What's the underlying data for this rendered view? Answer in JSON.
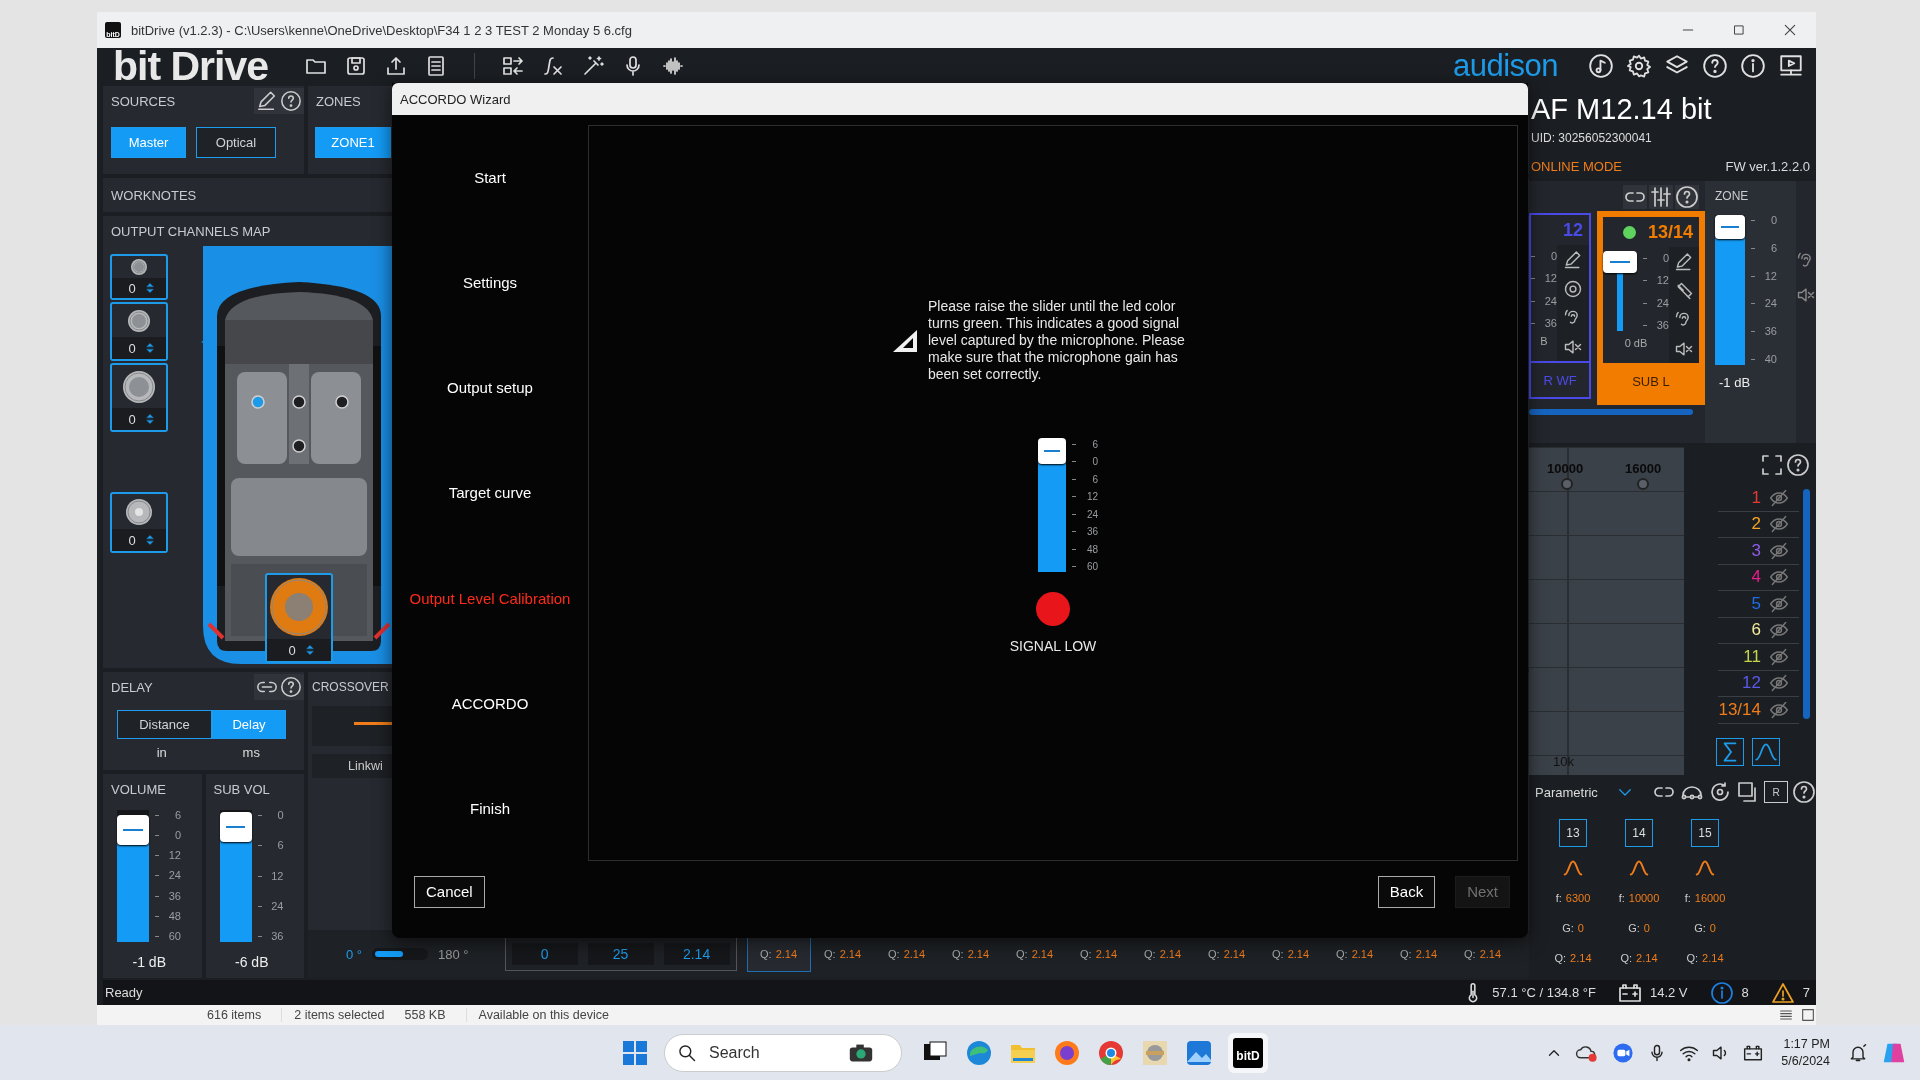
{
  "window": {
    "icon_label": "bitD",
    "title": "bitDrive (v1.2.3) - C:\\Users\\kenne\\OneDrive\\Desktop\\F34 1 2 3 TEST 2 Monday 5 6.cfg"
  },
  "header": {
    "logo": "bit Drive",
    "brand": "audison"
  },
  "sources": {
    "title": "SOURCES",
    "items": [
      {
        "label": "Master",
        "selected": true
      },
      {
        "label": "Optical",
        "selected": false
      }
    ]
  },
  "zones": {
    "title": "ZONES",
    "items": [
      {
        "label": "ZONE1",
        "selected": true
      }
    ]
  },
  "worknotes": {
    "title": "WORKNOTES"
  },
  "output_map": {
    "title": "OUTPUT CHANNELS MAP",
    "speakers": [
      {
        "kind": "tweeter",
        "value": "0",
        "selected": false
      },
      {
        "kind": "midrange",
        "value": "0",
        "selected": false
      },
      {
        "kind": "woofer",
        "value": "0",
        "selected": false
      },
      {
        "kind": "fullrange",
        "value": "0",
        "selected": false
      },
      {
        "kind": "subwoofer",
        "value": "0",
        "selected": true
      }
    ],
    "listening_positions": [
      {
        "selected": true
      },
      {
        "selected": false
      },
      {
        "selected": false
      },
      {
        "selected": false
      }
    ]
  },
  "delay": {
    "title": "DELAY",
    "modes": [
      {
        "label": "Distance",
        "selected": false
      },
      {
        "label": "Delay",
        "selected": true
      }
    ],
    "units": [
      "in",
      "ms"
    ]
  },
  "volume": {
    "title": "VOLUME",
    "level": 0.85,
    "ticks": [
      "6",
      "0",
      "12",
      "24",
      "36",
      "48",
      "60"
    ],
    "reading": "-1 dB"
  },
  "sub_volume": {
    "title": "SUB VOL",
    "level": 0.87,
    "ticks": [
      "0",
      "6",
      "12",
      "24",
      "36"
    ],
    "reading": "-6 dB"
  },
  "crossover": {
    "title": "CROSSOVER",
    "filter_button": "Linkwi",
    "phase": {
      "min": "0 °",
      "max": "180 °",
      "level": 0.55
    }
  },
  "eq_strip": {
    "fields": [
      "0",
      "25",
      "2.14"
    ],
    "q_cells": [
      {
        "label": "Q:",
        "value": "2.14",
        "selected": true
      },
      {
        "label": "Q:",
        "value": "2.14",
        "selected": false
      },
      {
        "label": "Q:",
        "value": "2.14",
        "selected": false
      },
      {
        "label": "Q:",
        "value": "2.14",
        "selected": false
      },
      {
        "label": "Q:",
        "value": "2.14",
        "selected": false
      },
      {
        "label": "Q:",
        "value": "2.14",
        "selected": false
      },
      {
        "label": "Q:",
        "value": "2.14",
        "selected": false
      },
      {
        "label": "Q:",
        "value": "2.14",
        "selected": false
      },
      {
        "label": "Q:",
        "value": "2.14",
        "selected": false
      },
      {
        "label": "Q:",
        "value": "2.14",
        "selected": false
      },
      {
        "label": "Q:",
        "value": "2.14",
        "selected": false
      },
      {
        "label": "Q:",
        "value": "2.14",
        "selected": false
      }
    ]
  },
  "device": {
    "name": "AF M12.14 bit",
    "uid": "UID: 30256052300041",
    "mode": "ONLINE MODE",
    "firmware": "FW ver.1.2.2.0"
  },
  "mixer": {
    "channels": [
      {
        "number": "12",
        "name": "R WF",
        "color": "#4a4ae6",
        "selected": false,
        "led": false,
        "ticks": [
          "0",
          "12",
          "24",
          "36"
        ],
        "reading": "B"
      },
      {
        "number": "13/14",
        "name": "SUB L",
        "color": "#f27c00",
        "selected": true,
        "led": true,
        "level": 0.88,
        "ticks": [
          "0",
          "12",
          "24",
          "36"
        ],
        "reading": "0 dB"
      }
    ],
    "zone": {
      "title": "ZONE",
      "level": 0.92,
      "ticks": [
        "0",
        "6",
        "12",
        "24",
        "36",
        "40"
      ],
      "reading": "-1 dB"
    }
  },
  "graph": {
    "point_labels": [
      "10000",
      "16000"
    ],
    "axis_label": "10k"
  },
  "curves": [
    {
      "label": "1",
      "color": "#e53935",
      "visible": false
    },
    {
      "label": "2",
      "color": "#f5a623",
      "visible": false
    },
    {
      "label": "3",
      "color": "#8e5ce6",
      "visible": false
    },
    {
      "label": "4",
      "color": "#e91e8c",
      "visible": false
    },
    {
      "label": "5",
      "color": "#1e6ee8",
      "visible": false
    },
    {
      "label": "6",
      "color": "#f3ec9c",
      "visible": false
    },
    {
      "label": "11",
      "color": "#c6d44a",
      "visible": false
    },
    {
      "label": "12",
      "color": "#5a5ae8",
      "visible": false
    },
    {
      "label": "13/14",
      "color": "#f07d1a",
      "visible": false
    }
  ],
  "eq": {
    "mode": "Parametric",
    "r_button": "R",
    "bands": [
      {
        "number": "13",
        "params": [
          {
            "label": "f:",
            "value": "6300"
          },
          {
            "label": "G:",
            "value": "0"
          },
          {
            "label": "Q:",
            "value": "2.14"
          }
        ]
      },
      {
        "number": "14",
        "params": [
          {
            "label": "f:",
            "value": "10000"
          },
          {
            "label": "G:",
            "value": "0"
          },
          {
            "label": "Q:",
            "value": "2.14"
          }
        ]
      },
      {
        "number": "15",
        "params": [
          {
            "label": "f:",
            "value": "16000"
          },
          {
            "label": "G:",
            "value": "0"
          },
          {
            "label": "Q:",
            "value": "2.14"
          }
        ]
      }
    ]
  },
  "status_bar": {
    "message": "Ready",
    "temperature": "57.1 °C / 134.8 °F",
    "voltage": "14.2 V",
    "info_count": "8",
    "warning_count": "7"
  },
  "explorer_status": [
    "616 items",
    "2 items selected",
    "558 KB",
    "Available on this device"
  ],
  "wizard": {
    "title": "ACCORDO Wizard",
    "steps": [
      {
        "label": "Start",
        "selected": false
      },
      {
        "label": "Settings",
        "selected": false
      },
      {
        "label": "Output setup",
        "selected": false
      },
      {
        "label": "Target curve",
        "selected": false
      },
      {
        "label": "Output Level Calibration",
        "selected": true
      },
      {
        "label": "ACCORDO",
        "selected": false
      },
      {
        "label": "Finish",
        "selected": false
      }
    ],
    "message": "Please raise the slider until the led color turns green. This indicates a good signal level captured by the microphone. Please make sure that the microphone gain has been set correctly.",
    "slider": {
      "level": 0.91,
      "ticks": [
        "6",
        "0",
        "6",
        "12",
        "24",
        "36",
        "48",
        "60"
      ]
    },
    "signal": {
      "good": false,
      "label": "SIGNAL LOW"
    },
    "buttons": [
      {
        "label": "Cancel",
        "disabled": false
      },
      {
        "label": "Back",
        "disabled": false
      },
      {
        "label": "Next",
        "disabled": true
      }
    ]
  },
  "taskbar": {
    "search_placeholder": "Search",
    "active_app_label": "bitD",
    "time": "1:17 PM",
    "date": "5/6/2024"
  }
}
